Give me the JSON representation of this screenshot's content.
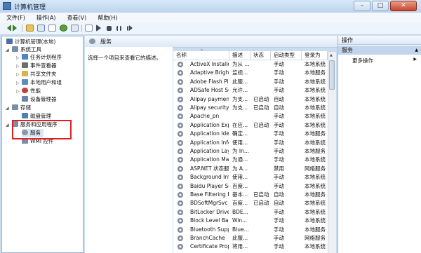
{
  "window": {
    "title": "计算机管理"
  },
  "menu": [
    "文件(F)",
    "操作(A)",
    "查看(V)",
    "帮助(H)"
  ],
  "tree": [
    {
      "label": "计算机管理(本地)",
      "color": "#4a6fa5"
    },
    {
      "label": "系统工具",
      "color": "#7b8ea8"
    },
    {
      "label": "任务计划程序",
      "color": "#4d86c6"
    },
    {
      "label": "事件查看器",
      "color": "#6d6d6d"
    },
    {
      "label": "共享文件夹",
      "color": "#d9b24a"
    },
    {
      "label": "本地用户和组",
      "color": "#5a8dbf"
    },
    {
      "label": "性能",
      "color": "#c83b3b"
    },
    {
      "label": "设备管理器",
      "color": "#6b86a3"
    },
    {
      "label": "存储",
      "color": "#7b8ea8"
    },
    {
      "label": "磁盘管理",
      "color": "#4f7fb5"
    },
    {
      "label": "服务和应用程序",
      "color": "#7b8ea8"
    },
    {
      "label": "服务",
      "color": "#8a97a8"
    },
    {
      "label": "WMI 控件",
      "color": "#7b8ea8"
    }
  ],
  "services_panel": {
    "title": "服务",
    "description": "选择一个项目来查看它的描述。",
    "columns": [
      "名称",
      "描述",
      "状态",
      "启动类型",
      "登录为"
    ],
    "rows": [
      [
        "ActiveX Installer ...",
        "为从 ...",
        "",
        "手动",
        "本地系统"
      ],
      [
        "Adaptive Brightn...",
        "监视...",
        "",
        "手动",
        "本地服务"
      ],
      [
        "Adobe Flash Pla...",
        "此服...",
        "",
        "手动",
        "本地系统"
      ],
      [
        "ADSafe Host Ser...",
        "允许...",
        "",
        "手动",
        "本地系统"
      ],
      [
        "Alipay payment ...",
        "为支...",
        "已启动",
        "自动",
        "本地系统"
      ],
      [
        "Alipay security b...",
        "为支...",
        "已启动",
        "自动",
        "本地系统"
      ],
      [
        "Apache_pn",
        "",
        "",
        "手动",
        "本地系统"
      ],
      [
        "Application Expe...",
        "在应...",
        "已启动",
        "手动",
        "本地系统"
      ],
      [
        "Application Iden...",
        "确定...",
        "",
        "手动",
        "本地服务"
      ],
      [
        "Application Infor...",
        "使用...",
        "",
        "手动",
        "本地系统"
      ],
      [
        "Application Laye...",
        "为 In...",
        "",
        "手动",
        "本地服务"
      ],
      [
        "Application Man...",
        "为通...",
        "",
        "手动",
        "本地系统"
      ],
      [
        "ASP.NET 状态服务",
        "为 A...",
        "",
        "禁用",
        "网络服务"
      ],
      [
        "Background Inte...",
        "使用...",
        "",
        "手动",
        "本地系统"
      ],
      [
        "Baidu Player Ser...",
        "百度...",
        "",
        "手动",
        "本地系统"
      ],
      [
        "Base Filtering En...",
        "基本...",
        "已启动",
        "自动",
        "本地服务"
      ],
      [
        "BDSoftMgrSvc",
        "百度...",
        "已启动",
        "自动",
        "本地系统"
      ],
      [
        "BitLocker Drive ...",
        "BDE...",
        "",
        "手动",
        "本地系统"
      ],
      [
        "Block Level Back...",
        "Win...",
        "",
        "手动",
        "本地系统"
      ],
      [
        "Bluetooth Supp...",
        "Blue...",
        "",
        "手动",
        "本地服务"
      ],
      [
        "BranchCache",
        "此服...",
        "",
        "手动",
        "网络服务"
      ],
      [
        "Certificate Propa...",
        "将用...",
        "",
        "手动",
        "本地系统"
      ]
    ]
  },
  "actions_panel": {
    "title": "操作",
    "section": "服务",
    "more": "更多操作"
  }
}
